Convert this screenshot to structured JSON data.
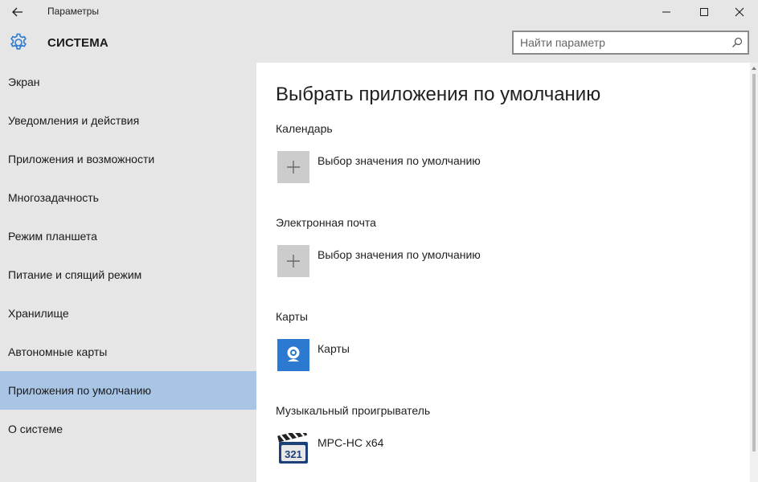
{
  "window": {
    "title": "Параметры"
  },
  "header": {
    "section_title": "СИСТЕМА",
    "search_placeholder": "Найти параметр",
    "accent_color": "#2b79d0"
  },
  "sidebar": {
    "items": [
      {
        "label": "Экран",
        "selected": false
      },
      {
        "label": "Уведомления и действия",
        "selected": false
      },
      {
        "label": "Приложения и возможности",
        "selected": false
      },
      {
        "label": "Многозадачность",
        "selected": false
      },
      {
        "label": "Режим планшета",
        "selected": false
      },
      {
        "label": "Питание и спящий режим",
        "selected": false
      },
      {
        "label": "Хранилище",
        "selected": false
      },
      {
        "label": "Автономные карты",
        "selected": false
      },
      {
        "label": "Приложения по умолчанию",
        "selected": true
      },
      {
        "label": "О системе",
        "selected": false
      }
    ],
    "selected_color": "#a9c5e6"
  },
  "main": {
    "page_title": "Выбрать приложения по умолчанию",
    "categories": [
      {
        "label": "Календарь",
        "app_name": "Выбор значения по умолчанию",
        "icon": "plus-icon"
      },
      {
        "label": "Электронная почта",
        "app_name": "Выбор значения по умолчанию",
        "icon": "plus-icon"
      },
      {
        "label": "Карты",
        "app_name": "Карты",
        "icon": "maps-app-icon"
      },
      {
        "label": "Музыкальный проигрыватель",
        "app_name": "MPC-HC x64",
        "icon": "mpc-hc-icon"
      }
    ],
    "mpc_icon_text": "321"
  }
}
